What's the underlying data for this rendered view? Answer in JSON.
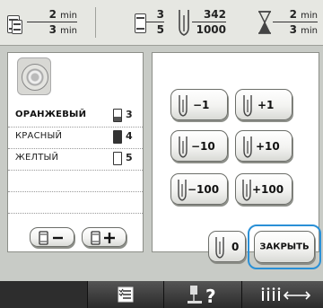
{
  "status_bar": {
    "time_remaining_value": "2",
    "time_remaining_unit": "min",
    "time_total_value": "3",
    "time_total_unit": "min",
    "color_current": "3",
    "color_total": "5",
    "stitch_current": "342",
    "stitch_total": "1000",
    "time_elapsed_value": "2",
    "time_elapsed_unit": "min",
    "time_elapsed_total_value": "3",
    "time_elapsed_total_unit": "min"
  },
  "color_list": {
    "items": [
      {
        "name": "ОРАНЖЕВЫЙ",
        "needle": "3",
        "selected": true
      },
      {
        "name": "КРАСНЫЙ",
        "needle": "4",
        "selected": false
      },
      {
        "name": "ЖЕЛТЫЙ",
        "needle": "5",
        "selected": false
      }
    ]
  },
  "stitch_buttons": {
    "minus_1": "−1",
    "plus_1": "+1",
    "minus_10": "−10",
    "plus_10": "+10",
    "minus_100": "−100",
    "plus_100": "+100",
    "zero": "0"
  },
  "close_button": "ЗАКРЫТЬ",
  "bottom_bar": {
    "tabs": [
      "color-sort",
      "needle-help",
      "stitch-move"
    ]
  }
}
